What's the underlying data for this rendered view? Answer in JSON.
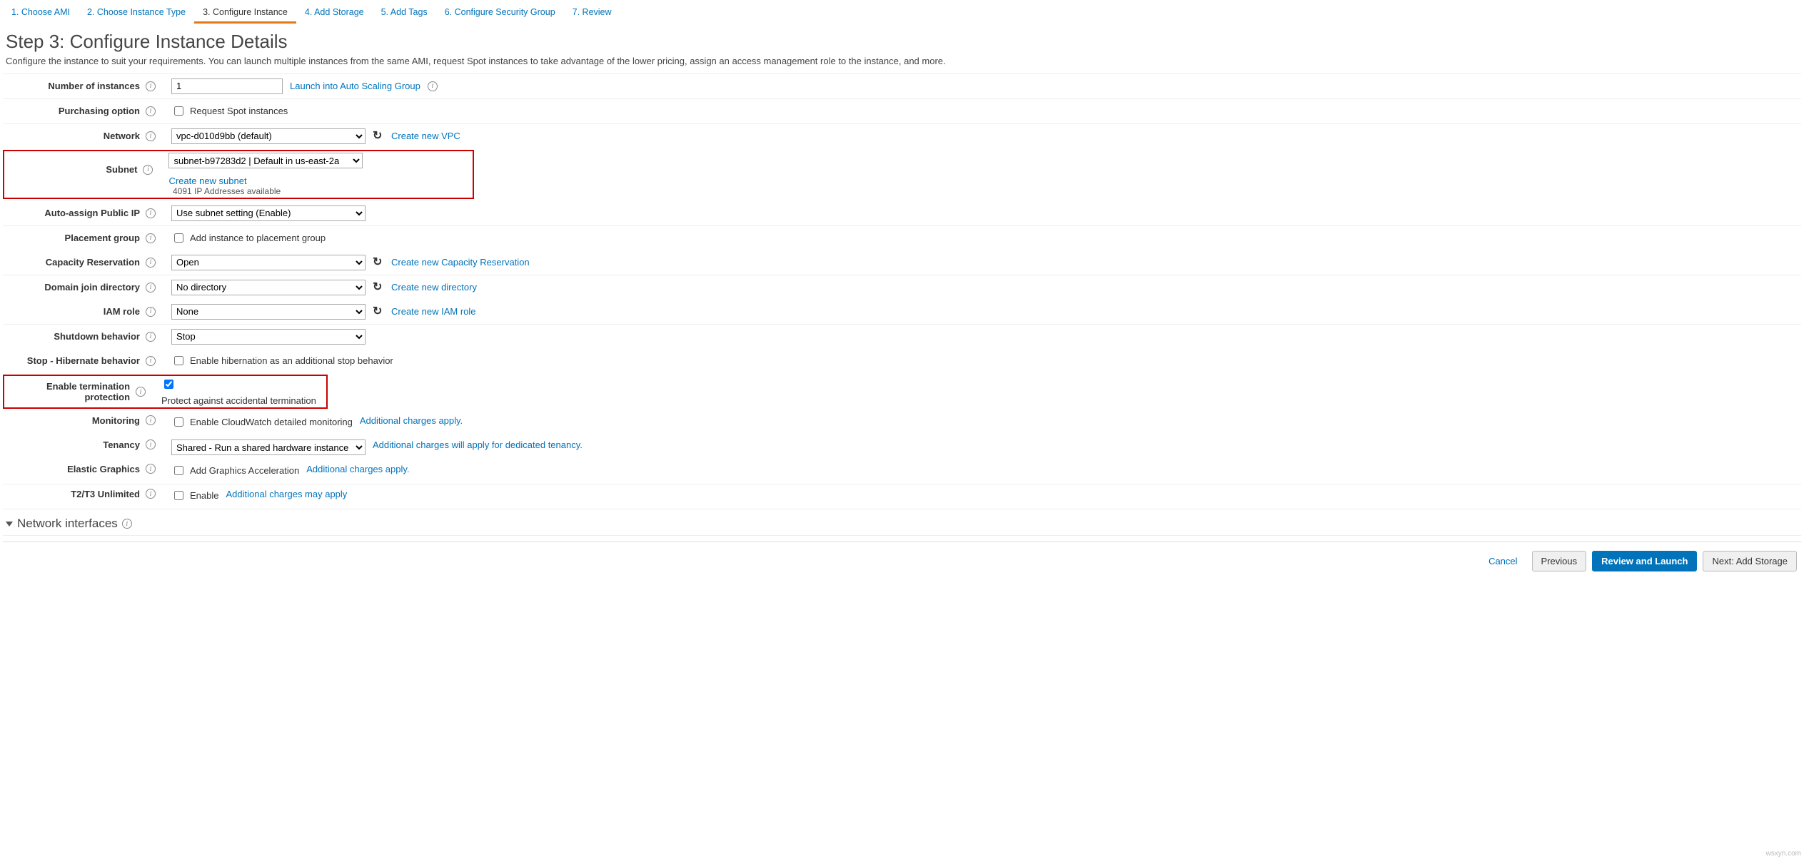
{
  "wizard": {
    "tabs": [
      "1. Choose AMI",
      "2. Choose Instance Type",
      "3. Configure Instance",
      "4. Add Storage",
      "5. Add Tags",
      "6. Configure Security Group",
      "7. Review"
    ],
    "active_index": 2
  },
  "page": {
    "title": "Step 3: Configure Instance Details",
    "description": "Configure the instance to suit your requirements. You can launch multiple instances from the same AMI, request Spot instances to take advantage of the lower pricing, assign an access management role to the instance, and more."
  },
  "form": {
    "instances": {
      "label": "Number of instances",
      "value": "1",
      "link": "Launch into Auto Scaling Group"
    },
    "purchasing": {
      "label": "Purchasing option",
      "checkbox_label": "Request Spot instances",
      "checked": false
    },
    "network": {
      "label": "Network",
      "value": "vpc-d010d9bb (default)",
      "link": "Create new VPC"
    },
    "subnet": {
      "label": "Subnet",
      "value": "subnet-b97283d2 | Default in us-east-2a",
      "hint": "4091 IP Addresses available",
      "link": "Create new subnet"
    },
    "public_ip": {
      "label": "Auto-assign Public IP",
      "value": "Use subnet setting (Enable)"
    },
    "placement": {
      "label": "Placement group",
      "checkbox_label": "Add instance to placement group",
      "checked": false
    },
    "capacity": {
      "label": "Capacity Reservation",
      "value": "Open",
      "link": "Create new Capacity Reservation"
    },
    "domain": {
      "label": "Domain join directory",
      "value": "No directory",
      "link": "Create new directory"
    },
    "iam": {
      "label": "IAM role",
      "value": "None",
      "link": "Create new IAM role"
    },
    "shutdown": {
      "label": "Shutdown behavior",
      "value": "Stop"
    },
    "hibernate": {
      "label": "Stop - Hibernate behavior",
      "checkbox_label": "Enable hibernation as an additional stop behavior",
      "checked": false
    },
    "term_protect": {
      "label": "Enable termination protection",
      "checkbox_label": "Protect against accidental termination",
      "checked": true
    },
    "monitoring": {
      "label": "Monitoring",
      "checkbox_label": "Enable CloudWatch detailed monitoring",
      "checked": false,
      "note": "Additional charges apply."
    },
    "tenancy": {
      "label": "Tenancy",
      "value": "Shared - Run a shared hardware instance",
      "note": "Additional charges will apply for dedicated tenancy."
    },
    "graphics": {
      "label": "Elastic Graphics",
      "checkbox_label": "Add Graphics Acceleration",
      "checked": false,
      "note": "Additional charges apply."
    },
    "unlimited": {
      "label": "T2/T3 Unlimited",
      "checkbox_label": "Enable",
      "checked": false,
      "note": "Additional charges may apply"
    }
  },
  "network_section": {
    "title": "Network interfaces"
  },
  "footer": {
    "cancel": "Cancel",
    "previous": "Previous",
    "review": "Review and Launch",
    "next": "Next: Add Storage"
  },
  "watermark": "wsxyn.com"
}
